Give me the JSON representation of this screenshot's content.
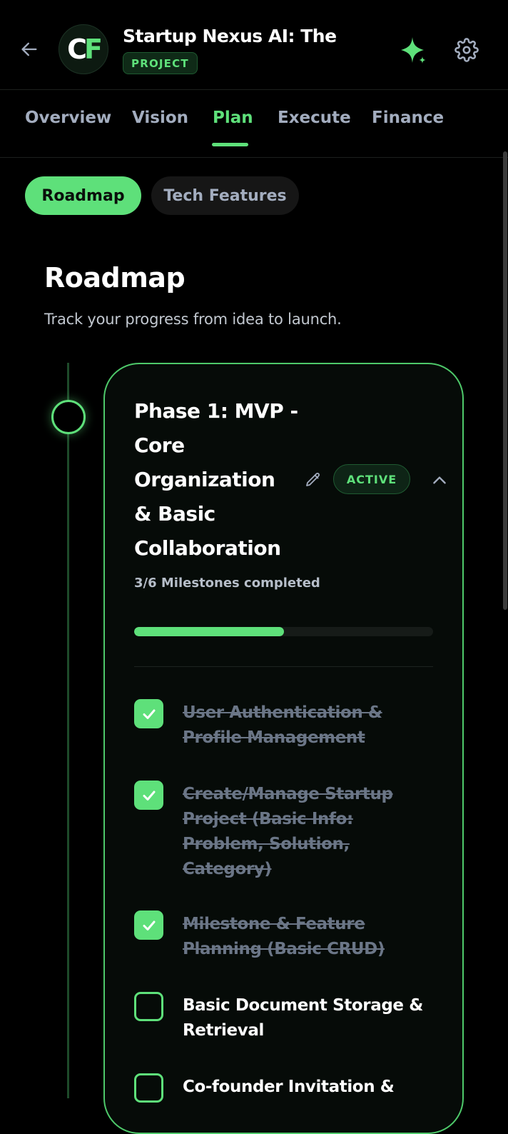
{
  "header": {
    "avatar_initials_left": "C",
    "avatar_initials_right": "F",
    "title": "Startup Nexus AI: The...",
    "badge": "PROJECT"
  },
  "tabs": [
    {
      "label": "Overview",
      "active": false
    },
    {
      "label": "Vision",
      "active": false
    },
    {
      "label": "Plan",
      "active": true
    },
    {
      "label": "Execute",
      "active": false
    },
    {
      "label": "Finance",
      "active": false
    }
  ],
  "subtabs": [
    {
      "label": "Roadmap",
      "active": true
    },
    {
      "label": "Tech Features",
      "active": false
    }
  ],
  "section": {
    "title": "Roadmap",
    "subtitle": "Track your progress from idea to launch."
  },
  "phase": {
    "title": "Phase 1: MVP - Core Organization & Basic Collaboration",
    "status": "ACTIVE",
    "milestones_summary": "3/6 Milestones completed",
    "progress": 0.5,
    "milestones": [
      {
        "label": "User Authentication & Profile Management",
        "completed": true
      },
      {
        "label": "Create/Manage Startup Project (Basic Info: Problem, Solution, Category)",
        "completed": true
      },
      {
        "label": "Milestone & Feature Planning (Basic CRUD)",
        "completed": true
      },
      {
        "label": "Basic Document Storage & Retrieval",
        "completed": false
      },
      {
        "label": "Co-founder Invitation &",
        "completed": false
      }
    ]
  },
  "colors": {
    "accent": "#5ee07a",
    "background": "#000000",
    "muted_text": "#a3adbf"
  },
  "icons": {
    "back": "arrow-left-icon",
    "ai": "sparkle-icon",
    "settings": "gear-icon",
    "edit": "pencil-icon",
    "collapse": "chevron-up-icon",
    "check": "check-icon"
  }
}
